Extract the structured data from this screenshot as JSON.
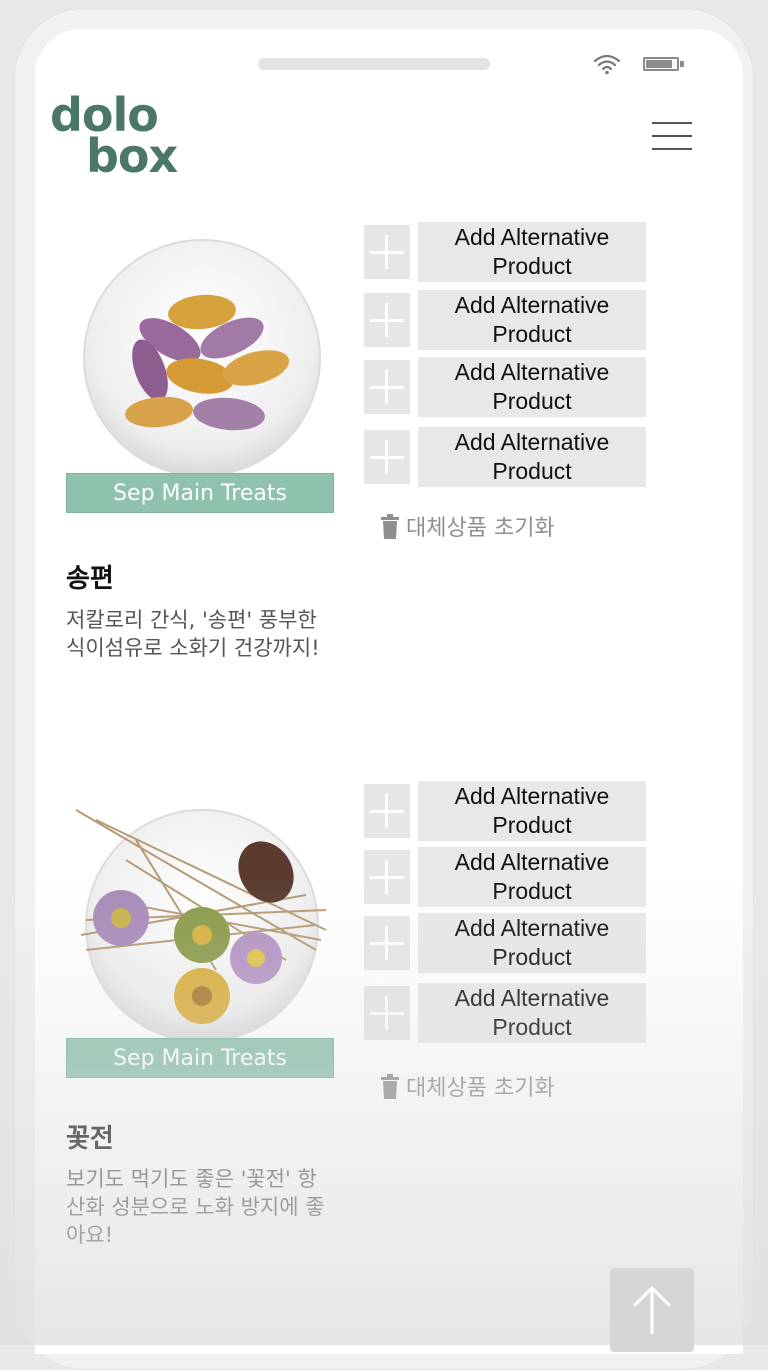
{
  "header": {
    "logo_line1": "dolo",
    "logo_line2": "box"
  },
  "products": [
    {
      "category": "Sep Main Treats",
      "name": "송편",
      "description": "저칼로리 간식, '송편' 풍부한 식이섬유로 소화기 건강까지!",
      "alternatives": [
        "Add Alternative Product",
        "Add Alternative Product",
        "Add Alternative Product",
        "Add Alternative Product"
      ],
      "reset_label": "대체상품 초기화"
    },
    {
      "category": "Sep Main Treats",
      "name": "꽃전",
      "description": "보기도 먹기도 좋은 '꽃전' 항산화 성분으로 노화 방지에 좋아요!",
      "alternatives": [
        "Add Alternative Product",
        "Add Alternative Product",
        "Add Alternative Product",
        "Add Alternative Product"
      ],
      "reset_label": "대체상품 초기화"
    }
  ],
  "icons": {
    "wifi": "wifi-icon",
    "battery": "battery-icon",
    "menu": "hamburger-menu-icon",
    "plus": "plus-icon",
    "trash": "trash-icon",
    "scroll_top": "arrow-up-icon"
  },
  "colors": {
    "brand": "#4a7767",
    "category_bg": "#8ec2ac",
    "button_bg": "#e8e8e8"
  }
}
